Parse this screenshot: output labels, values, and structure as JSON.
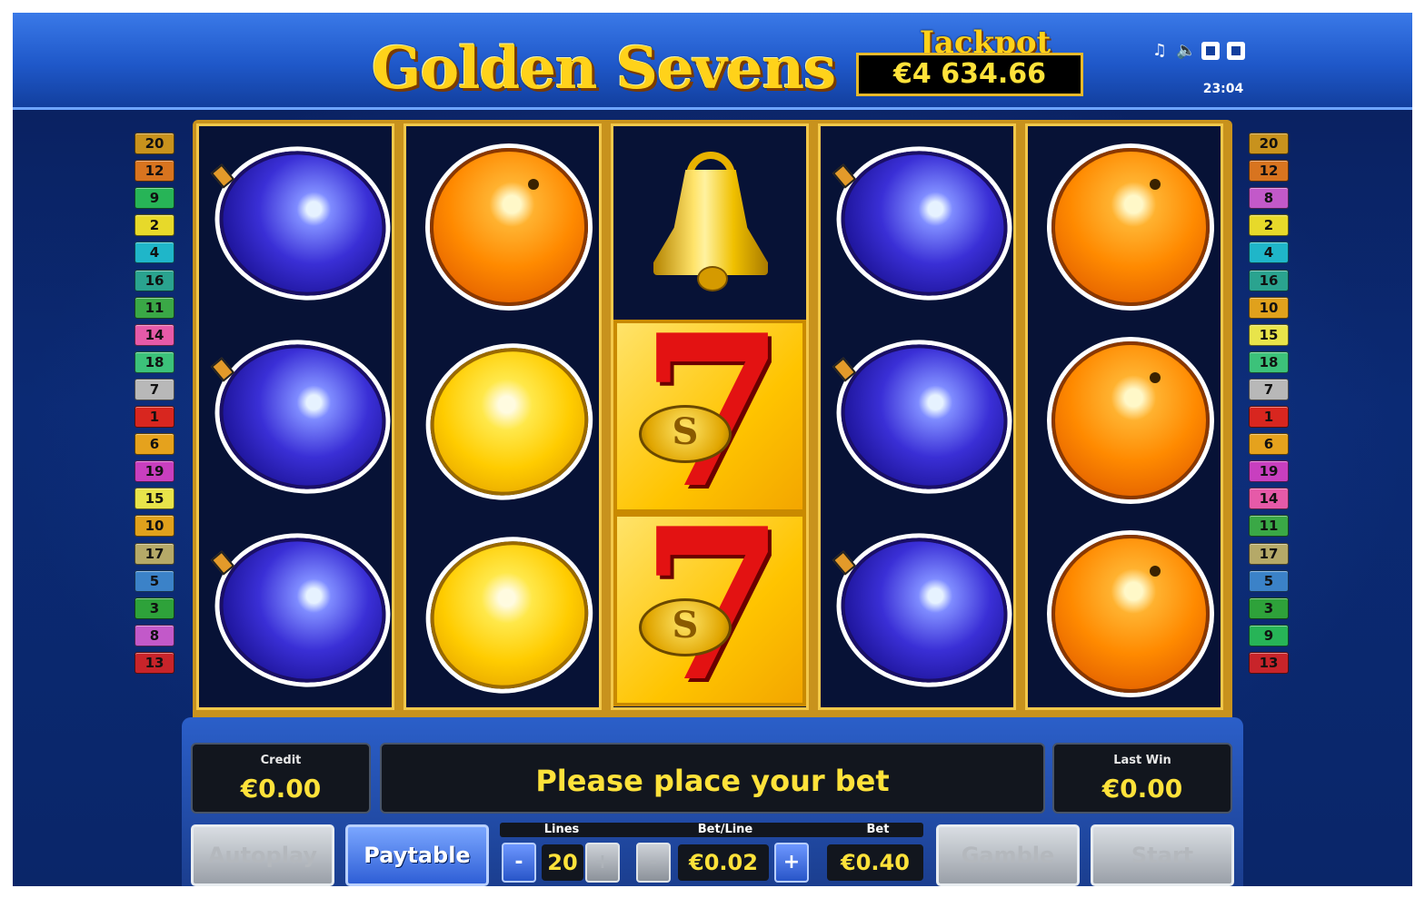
{
  "header": {
    "title": "Golden Sevens",
    "jackpot_label": "Jackpot",
    "jackpot_value": "€4 634.66",
    "clock": "23:04",
    "icons": [
      "music-icon",
      "speaker-icon",
      "fullscreen-icon",
      "settings-icon"
    ]
  },
  "reels": [
    [
      "plum",
      "plum",
      "plum"
    ],
    [
      "orange",
      "lemon",
      "lemon"
    ],
    [
      "bell",
      "seven",
      "seven"
    ],
    [
      "plum",
      "plum",
      "plum"
    ],
    [
      "orange",
      "orange",
      "orange"
    ]
  ],
  "line_badges": {
    "left": [
      {
        "label": "20",
        "color": "#c8921d"
      },
      {
        "label": "12",
        "color": "#d8741f"
      },
      {
        "label": "9",
        "color": "#27b457"
      },
      {
        "label": "2",
        "color": "#e7d92a"
      },
      {
        "label": "4",
        "color": "#1fb6c9"
      },
      {
        "label": "16",
        "color": "#2aa38f"
      },
      {
        "label": "11",
        "color": "#3aa846"
      },
      {
        "label": "14",
        "color": "#e65aa8"
      },
      {
        "label": "18",
        "color": "#3cc27a"
      },
      {
        "label": "7",
        "color": "#b8b8b8"
      },
      {
        "label": "1",
        "color": "#d8261f"
      },
      {
        "label": "6",
        "color": "#e5a21d"
      },
      {
        "label": "19",
        "color": "#c83fbf"
      },
      {
        "label": "15",
        "color": "#e8e44a"
      },
      {
        "label": "10",
        "color": "#e0a11c"
      },
      {
        "label": "17",
        "color": "#b5a968"
      },
      {
        "label": "5",
        "color": "#3b82c8"
      },
      {
        "label": "3",
        "color": "#2ea23a"
      },
      {
        "label": "8",
        "color": "#c259c9"
      },
      {
        "label": "13",
        "color": "#c8242a"
      }
    ],
    "right": [
      {
        "label": "20",
        "color": "#c8921d"
      },
      {
        "label": "12",
        "color": "#d8741f"
      },
      {
        "label": "8",
        "color": "#c259c9"
      },
      {
        "label": "2",
        "color": "#e7d92a"
      },
      {
        "label": "4",
        "color": "#1fb6c9"
      },
      {
        "label": "16",
        "color": "#2aa38f"
      },
      {
        "label": "10",
        "color": "#e0a11c"
      },
      {
        "label": "15",
        "color": "#e8e44a"
      },
      {
        "label": "18",
        "color": "#3cc27a"
      },
      {
        "label": "7",
        "color": "#b8b8b8"
      },
      {
        "label": "1",
        "color": "#d8261f"
      },
      {
        "label": "6",
        "color": "#e5a21d"
      },
      {
        "label": "19",
        "color": "#c83fbf"
      },
      {
        "label": "14",
        "color": "#e65aa8"
      },
      {
        "label": "11",
        "color": "#3aa846"
      },
      {
        "label": "17",
        "color": "#b5a968"
      },
      {
        "label": "5",
        "color": "#3b82c8"
      },
      {
        "label": "3",
        "color": "#2ea23a"
      },
      {
        "label": "9",
        "color": "#27b457"
      },
      {
        "label": "13",
        "color": "#c8242a"
      }
    ]
  },
  "panel": {
    "credit_label": "Credit",
    "credit_value": "€0.00",
    "message": "Please place your bet",
    "last_win_label": "Last Win",
    "last_win_value": "€0.00",
    "autoplay_label": "Autoplay",
    "paytable_label": "Paytable",
    "lines_label": "Lines",
    "lines_value": "20",
    "minus_label": "-",
    "plus_label": "+",
    "betline_label": "Bet/Line",
    "betline_value": "€0.02",
    "bet_label": "Bet",
    "bet_value": "€0.40",
    "gamble_label": "Gamble",
    "start_label": "Start"
  },
  "colors": {
    "accent_yellow": "#ffe23a",
    "panel_blue": "#2b5fc9",
    "reel_bg": "#071236"
  }
}
